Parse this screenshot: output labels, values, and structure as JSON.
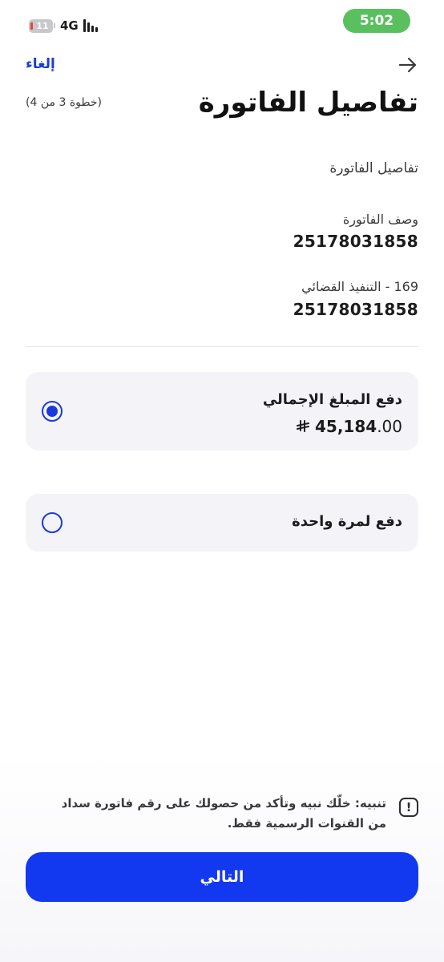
{
  "status_bar": {
    "battery_level": "11",
    "network": "4G",
    "time": "5:02"
  },
  "header": {
    "cancel_label": "إلغاء",
    "title": "تفاصيل الفاتورة",
    "step": "(خطوة 3 من 4)",
    "back_icon": "arrow-right-icon"
  },
  "details": {
    "section_label": "تفاصيل الفاتورة",
    "fields": [
      {
        "label": "وصف الفاتورة",
        "value": "25178031858"
      },
      {
        "label": "169 - التنفيذ القضائي",
        "value": "25178031858"
      }
    ]
  },
  "options": [
    {
      "title": "دفع المبلغ الإجمالي",
      "amount_main": "45,184",
      "amount_decimals": ".00",
      "currency_icon": "riyal-symbol-icon",
      "selected": true
    },
    {
      "title": "دفع لمرة واحدة",
      "selected": false
    }
  ],
  "warning": {
    "text": "تنبيه: خلّك نبيه وتأكد من حصولك على رقم فاتورة سداد من القنوات الرسمية فقط.",
    "icon": "exclamation-icon"
  },
  "footer": {
    "next_label": "التالي"
  },
  "colors": {
    "accent": "#1238f0",
    "link": "#1a3bd8",
    "time_pill": "#5ac05f",
    "card_bg": "#f4f4f8"
  }
}
